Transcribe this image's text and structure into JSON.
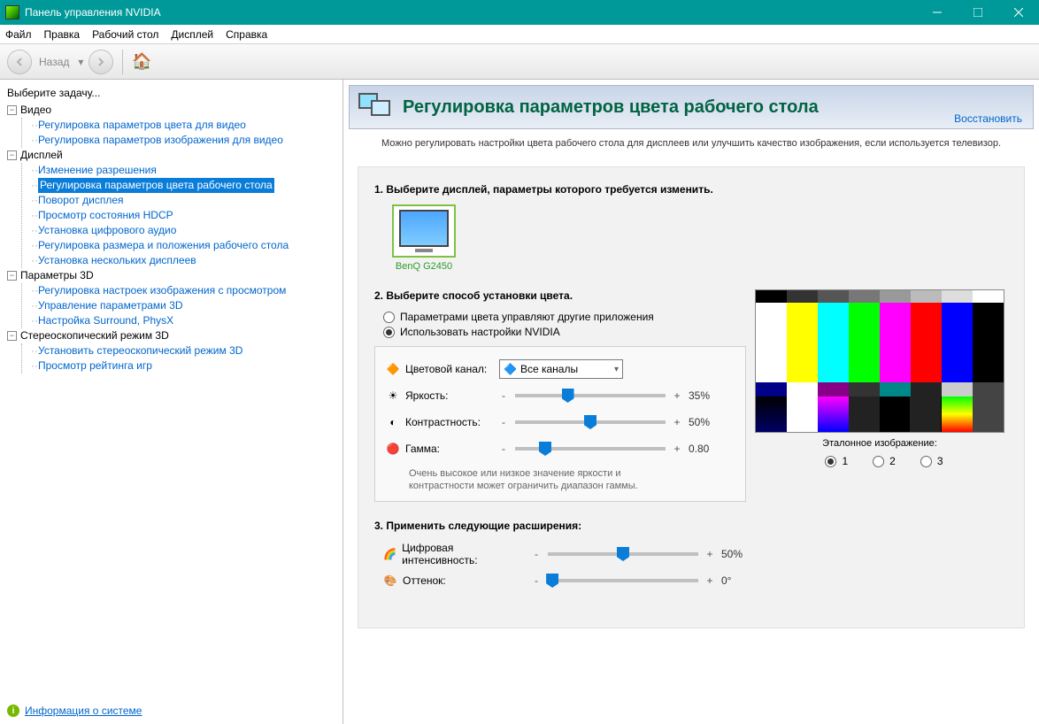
{
  "window": {
    "title": "Панель управления NVIDIA"
  },
  "menu": {
    "file": "Файл",
    "edit": "Правка",
    "desktop": "Рабочий стол",
    "display": "Дисплей",
    "help": "Справка"
  },
  "toolbar": {
    "back": "Назад"
  },
  "sidebar": {
    "task": "Выберите задачу...",
    "footer": "Информация о системе",
    "groups": [
      {
        "label": "Видео",
        "items": [
          "Регулировка параметров цвета для видео",
          "Регулировка параметров изображения для видео"
        ]
      },
      {
        "label": "Дисплей",
        "items": [
          "Изменение разрешения",
          "Регулировка параметров цвета рабочего стола",
          "Поворот дисплея",
          "Просмотр состояния HDCP",
          "Установка цифрового аудио",
          "Регулировка размера и положения рабочего стола",
          "Установка нескольких дисплеев"
        ],
        "selected": 1
      },
      {
        "label": "Параметры 3D",
        "items": [
          "Регулировка настроек изображения с просмотром",
          "Управление параметрами 3D",
          "Настройка Surround, PhysX"
        ]
      },
      {
        "label": "Стереоскопический режим 3D",
        "items": [
          "Установить стереоскопический режим 3D",
          "Просмотр рейтинга игр"
        ]
      }
    ]
  },
  "header": {
    "title": "Регулировка параметров цвета рабочего стола",
    "restore": "Восстановить"
  },
  "intro": "Можно регулировать настройки цвета рабочего стола для дисплеев или улучшить качество изображения, если используется телевизор.",
  "step1": {
    "title": "1. Выберите дисплей, параметры которого требуется изменить.",
    "monitor": "BenQ G2450"
  },
  "step2": {
    "title": "2. Выберите способ установки цвета.",
    "opt_other": "Параметрами цвета управляют другие приложения",
    "opt_nvidia": "Использовать настройки NVIDIA",
    "channel_label": "Цветовой канал:",
    "channel_value": "Все каналы",
    "brightness": "Яркость:",
    "contrast": "Контрастность:",
    "gamma": "Гамма:",
    "brightness_val": "35%",
    "contrast_val": "50%",
    "gamma_val": "0.80",
    "note1": "Очень высокое или низкое значение яркости и",
    "note2": "контрастности может ограничить диапазон гаммы."
  },
  "step3": {
    "title": "3. Применить следующие расширения:",
    "vibrance": "Цифровая интенсивность:",
    "hue": "Оттенок:",
    "vibrance_val": "50%",
    "hue_val": "0°"
  },
  "reference": {
    "label": "Эталонное изображение:",
    "r1": "1",
    "r2": "2",
    "r3": "3"
  }
}
